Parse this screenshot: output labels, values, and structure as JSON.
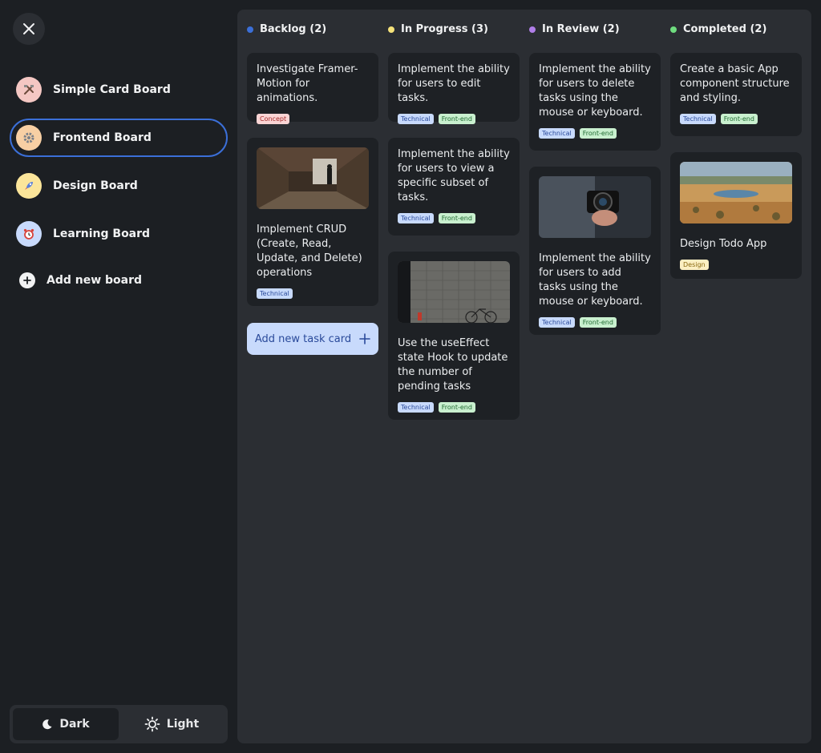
{
  "sidebar": {
    "boards": [
      {
        "label": "Simple Card Board",
        "icon": "hammer-wrench-icon",
        "icon_bg": "#f4c7c3",
        "active": false
      },
      {
        "label": "Frontend Board",
        "icon": "gear-icon",
        "icon_bg": "#f7cfa4",
        "active": true
      },
      {
        "label": "Design Board",
        "icon": "rocket-icon",
        "icon_bg": "#fbe59a",
        "active": false
      },
      {
        "label": "Learning Board",
        "icon": "alarm-clock-icon",
        "icon_bg": "#c8dafc",
        "active": false
      }
    ],
    "add_board_label": "Add new board",
    "theme": {
      "dark_label": "Dark",
      "light_label": "Light",
      "active": "dark"
    }
  },
  "columns": [
    {
      "title": "Backlog (2)",
      "dot_color": "#3b6fd8",
      "cards": [
        {
          "title": "Investigate Framer-Motion for animations.",
          "tags": [
            "Concept"
          ]
        },
        {
          "title": "Implement CRUD (Create, Read, Update, and Delete) operations",
          "tags": [
            "Technical"
          ]
        }
      ]
    },
    {
      "title": "In Progress (3)",
      "dot_color": "#f5e27a",
      "cards": [
        {
          "title": "Implement the ability for users to edit tasks.",
          "tags": [
            "Technical",
            "Front-end"
          ]
        },
        {
          "title": "Implement the ability for users to view a specific subset of tasks.",
          "tags": [
            "Technical",
            "Front-end"
          ]
        },
        {
          "title": "Use the useEffect state Hook to update the number of pending tasks",
          "tags": [
            "Technical",
            "Front-end"
          ]
        }
      ]
    },
    {
      "title": "In Review  (2)",
      "dot_color": "#b07ee8",
      "cards": [
        {
          "title": "Implement the ability for users to delete tasks using the mouse or keyboard.",
          "tags": [
            "Technical",
            "Front-end"
          ]
        },
        {
          "title": "Implement the ability for users to add tasks using the mouse or keyboard.",
          "tags": [
            "Technical",
            "Front-end"
          ]
        }
      ]
    },
    {
      "title": "Completed (2)",
      "dot_color": "#6fdc7f",
      "cards": [
        {
          "title": "Create a basic App component structure and styling.",
          "tags": [
            "Technical",
            "Front-end"
          ]
        },
        {
          "title": "Design Todo App",
          "tags": [
            "Design"
          ]
        }
      ]
    }
  ],
  "add_task_label": "Add new task card"
}
